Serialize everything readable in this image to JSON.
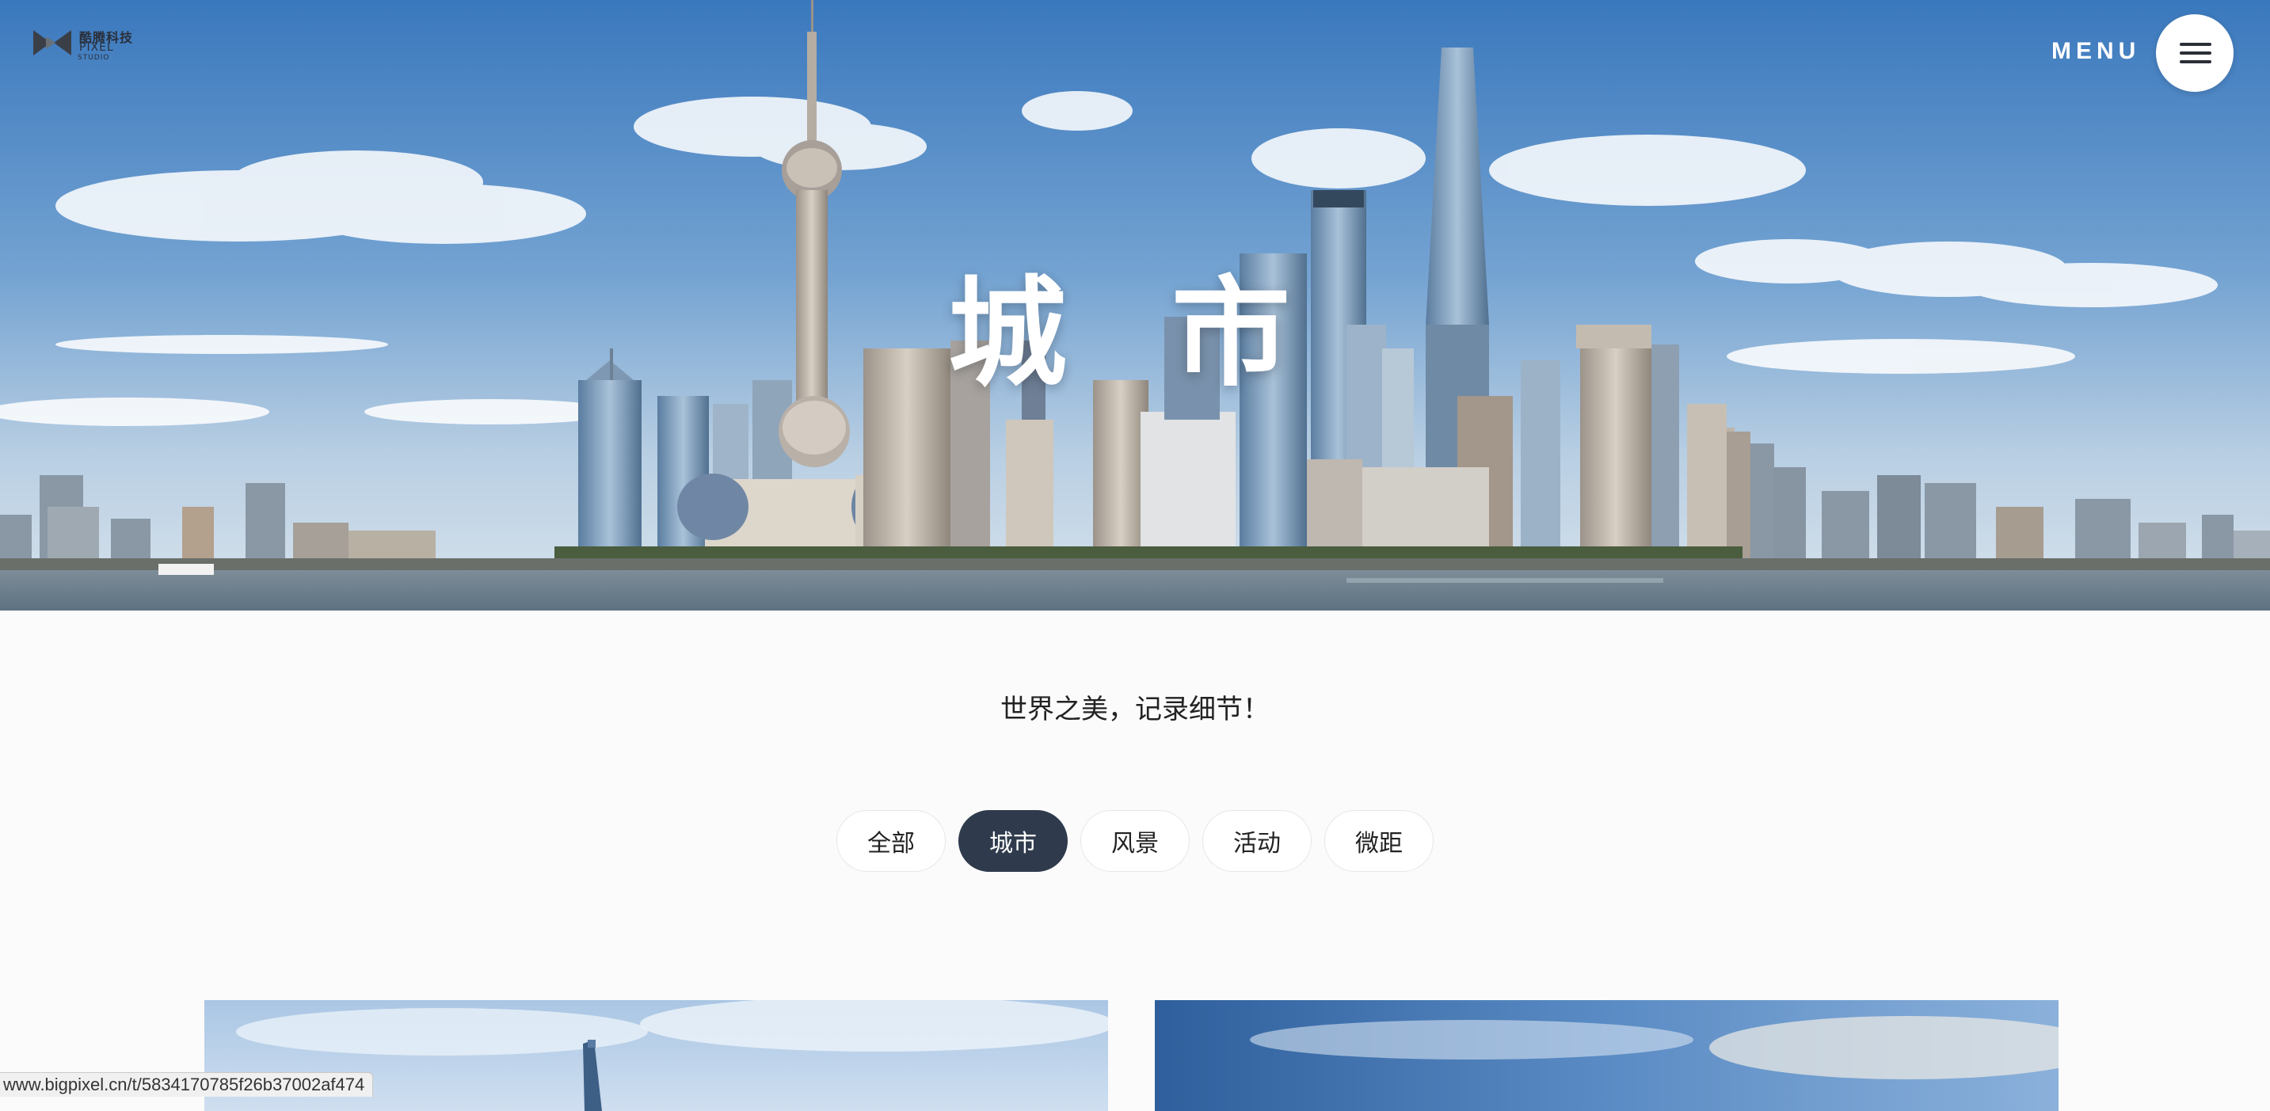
{
  "brand": {
    "name_cn": "酷腾科技",
    "name_en": "PIXEL",
    "sub": "STUDIO"
  },
  "nav": {
    "menu_label": "MENU"
  },
  "hero": {
    "title": "城 市"
  },
  "tagline": "世界之美，记录细节！",
  "filters": {
    "items": [
      {
        "label": "全部",
        "active": false
      },
      {
        "label": "城市",
        "active": true
      },
      {
        "label": "风景",
        "active": false
      },
      {
        "label": "活动",
        "active": false
      },
      {
        "label": "微距",
        "active": false
      }
    ]
  },
  "status": {
    "url": "www.bigpixel.cn/t/5834170785f26b37002af474"
  },
  "colors": {
    "active_pill": "#2f3b4d",
    "sky_top": "#3f7fc0",
    "water": "#6a7f8e"
  }
}
